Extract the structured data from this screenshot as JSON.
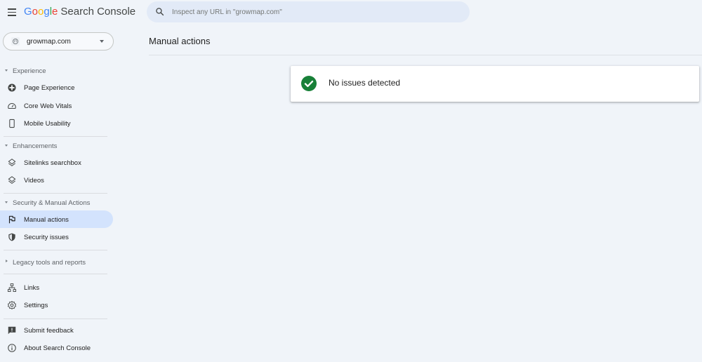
{
  "app": {
    "logo_google": [
      "G",
      "o",
      "o",
      "g",
      "l",
      "e"
    ],
    "logo_google_colors": [
      "#4285f4",
      "#ea4335",
      "#fbbc05",
      "#4285f4",
      "#34a853",
      "#ea4335"
    ],
    "logo_product": "Search Console"
  },
  "search": {
    "placeholder": "Inspect any URL in \"growmap.com\"",
    "value": ""
  },
  "property_selector": {
    "name": "growmap.com"
  },
  "sidebar": {
    "sections": [
      {
        "label": "Experience",
        "expanded": true,
        "items": [
          {
            "label": "Page Experience",
            "icon": "page-experience-icon"
          },
          {
            "label": "Core Web Vitals",
            "icon": "speedometer-icon"
          },
          {
            "label": "Mobile Usability",
            "icon": "phone-icon"
          }
        ]
      },
      {
        "label": "Enhancements",
        "expanded": true,
        "items": [
          {
            "label": "Sitelinks searchbox",
            "icon": "layers-icon"
          },
          {
            "label": "Videos",
            "icon": "layers-icon"
          }
        ]
      },
      {
        "label": "Security & Manual Actions",
        "expanded": true,
        "items": [
          {
            "label": "Manual actions",
            "icon": "flag-icon",
            "active": true
          },
          {
            "label": "Security issues",
            "icon": "shield-icon"
          }
        ]
      },
      {
        "label": "Legacy tools and reports",
        "expanded": false,
        "items": []
      }
    ],
    "bottom_group_1": [
      {
        "label": "Links",
        "icon": "sitemap-icon"
      },
      {
        "label": "Settings",
        "icon": "gear-icon"
      }
    ],
    "bottom_group_2": [
      {
        "label": "Submit feedback",
        "icon": "feedback-icon"
      },
      {
        "label": "About Search Console",
        "icon": "info-icon"
      }
    ]
  },
  "main": {
    "title": "Manual actions",
    "status_card": {
      "message": "No issues detected",
      "status_color": "#188038"
    }
  },
  "colors": {
    "page_bg": "#f0f4f9",
    "active_nav_bg": "#d3e3fd",
    "search_bg": "#e2eaf7"
  }
}
